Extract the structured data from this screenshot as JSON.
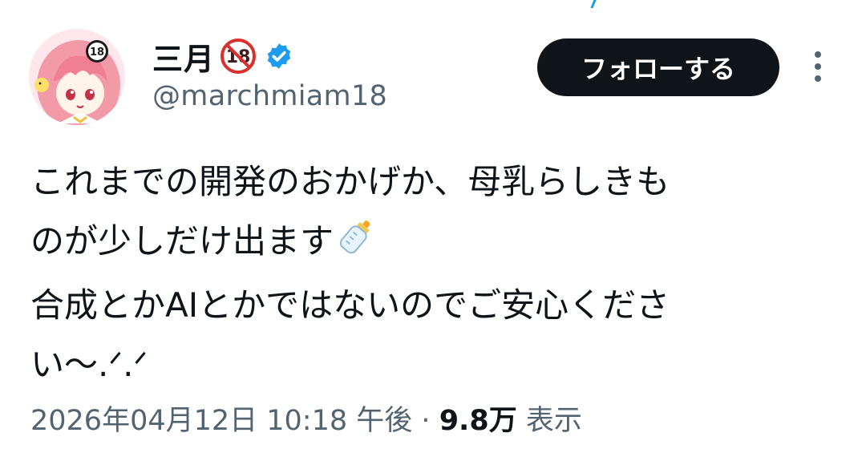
{
  "tweet": {
    "author": {
      "display_name": "三月",
      "name_badge": "18",
      "handle": "@marchmiam18",
      "verified": true,
      "avatar_icon": "anime-girl-avatar-icon"
    },
    "follow_button_label": "フォローする",
    "text_lines": [
      "これまでの開発のおかげか、母乳らしきも",
      "のが少しだけ出ます",
      "合成とかAIとかではないのでご安心くださ",
      "い〜.ᐟ.ᐟ"
    ],
    "emoji": "baby-bottle-icon",
    "timestamp": "2026年04月12日 10:18 午後",
    "separator": "·",
    "views_count": "9.8万",
    "views_label": "表示"
  },
  "colors": {
    "follow_button_bg": "#0f1419",
    "verified_blue": "#1d9bf0",
    "secondary_text": "#536471",
    "badge_red": "#d9302b"
  }
}
